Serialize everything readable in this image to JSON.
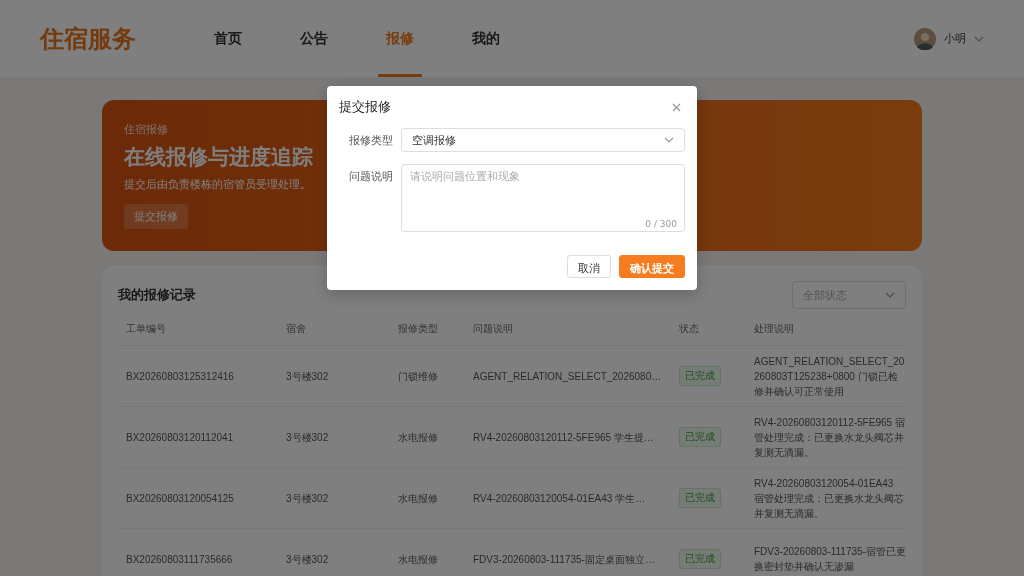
{
  "header": {
    "logo": "住宿服务",
    "nav": [
      {
        "label": "首页",
        "selected": false
      },
      {
        "label": "公告",
        "selected": false
      },
      {
        "label": "报修",
        "selected": true
      },
      {
        "label": "我的",
        "selected": false
      }
    ],
    "user": {
      "name": "小明"
    }
  },
  "banner": {
    "eyebrow": "住宿报修",
    "title": "在线报修与进度追踪",
    "subtitle": "提交后由负责楼栋的宿管员受理处理。",
    "button": "提交报修"
  },
  "records": {
    "title": "我的报修记录",
    "filter": {
      "value": "全部状态"
    },
    "columns": [
      "工单编号",
      "宿舍",
      "报修类型",
      "问题说明",
      "状态",
      "处理说明"
    ],
    "rows": [
      {
        "order_no": "BX20260803125312416",
        "dorm": "3号楼302",
        "type": "门锁维修",
        "problem": "AGENT_RELATION_SELECT_2026080…",
        "status": "已完成",
        "note": "AGENT_RELATION_SELECT_20260803T125238+0800 门锁已检修并确认可正常使用"
      },
      {
        "order_no": "BX20260803120112041",
        "dorm": "3号楼302",
        "type": "水电报修",
        "problem": "RV4-20260803120112-5FE965 学生提…",
        "status": "已完成",
        "note": "RV4-20260803120112-5FE965 宿管处理完成：已更换水龙头阀芯并复测无滴漏。"
      },
      {
        "order_no": "BX20260803120054125",
        "dorm": "3号楼302",
        "type": "水电报修",
        "problem": "RV4-20260803120054-01EA43 学生…",
        "status": "已完成",
        "note": "RV4-20260803120054-01EA43 宿管处理完成：已更换水龙头阀芯并复测无滴漏。"
      },
      {
        "order_no": "BX20260803111735666",
        "dorm": "3号楼302",
        "type": "水电报修",
        "problem": "FDV3-20260803-111735-固定桌面独立…",
        "status": "已完成",
        "note": "FDV3-20260803-111735-宿管已更换密封垫并确认无渗漏"
      }
    ]
  },
  "dialog": {
    "title": "提交报修",
    "fields": [
      {
        "kind": "select",
        "label": "报修类型",
        "value": "空调报修"
      },
      {
        "kind": "textarea",
        "label": "问题说明",
        "placeholder": "请说明问题位置和现象",
        "counter": "0 / 300"
      }
    ],
    "buttons": [
      {
        "label": "取消",
        "primary": false
      },
      {
        "label": "确认提交",
        "primary": true
      }
    ]
  }
}
